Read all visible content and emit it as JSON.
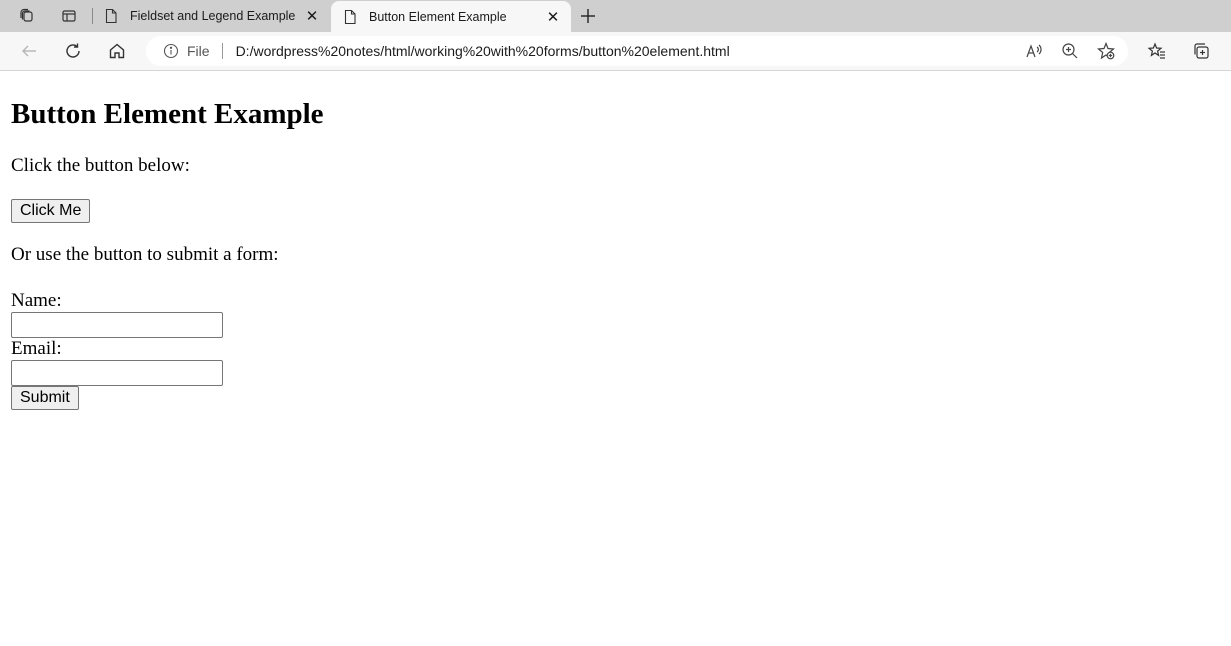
{
  "browser": {
    "tabs": [
      {
        "title": "Fieldset and Legend Example",
        "active": false
      },
      {
        "title": "Button Element Example",
        "active": true
      }
    ],
    "new_tab_icon": "plus-icon",
    "address": {
      "scheme_label": "File",
      "url": "D:/wordpress%20notes/html/working%20with%20forms/button%20element.html"
    }
  },
  "page": {
    "heading": "Button Element Example",
    "intro": "Click the button below:",
    "click_button_label": "Click Me",
    "form_intro": "Or use the button to submit a form:",
    "name_label": "Name:",
    "name_value": "",
    "email_label": "Email:",
    "email_value": "",
    "submit_label": "Submit"
  },
  "colors": {
    "tabbar_bg": "#cfcfcf",
    "toolbar_bg": "#f7f7f7",
    "button_bg": "#efefef"
  }
}
